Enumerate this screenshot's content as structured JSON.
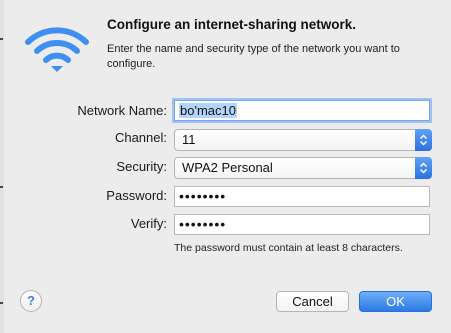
{
  "dialog": {
    "title": "Configure an internet-sharing network.",
    "description": "Enter the name and security type of the network you want to configure."
  },
  "form": {
    "network_name": {
      "label": "Network Name:",
      "value": "bo'mac10"
    },
    "channel": {
      "label": "Channel:",
      "value": "11"
    },
    "security": {
      "label": "Security:",
      "value": "WPA2 Personal"
    },
    "password": {
      "label": "Password:",
      "value": "••••••••"
    },
    "verify": {
      "label": "Verify:",
      "value": "••••••••"
    },
    "hint": "The password must contain at least 8 characters."
  },
  "buttons": {
    "help": "?",
    "cancel": "Cancel",
    "ok": "OK"
  },
  "icons": {
    "dialog_icon": "wifi-icon",
    "popup_arrows": "up-down-arrows-icon"
  },
  "colors": {
    "accent": "#2c7ae6",
    "wifi_blue": "#3f8ff0",
    "focus_ring": "#9ec3f2",
    "background": "#ececec"
  }
}
